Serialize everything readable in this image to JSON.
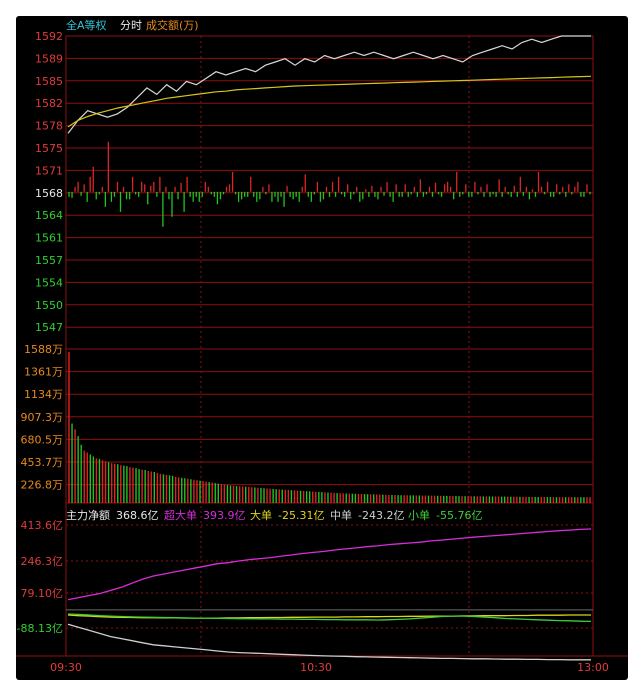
{
  "header": {
    "title": "全A等权",
    "mode": "分时",
    "volume_label": "成交额(万)"
  },
  "colors": {
    "bg": "#000000",
    "grid": "#8c0f0f",
    "axis_red": "#e23b3b",
    "axis_green": "#2fd02f",
    "axis_orange": "#e8891e",
    "title_cyan": "#2fc6d6",
    "price_line": "#d8d8d8",
    "avg_line": "#d6c61a",
    "up_bar": "#e02424",
    "down_bar": "#22c322",
    "super_large": "#d72ed7",
    "large": "#e0d418",
    "medium": "#cfcfcf",
    "small": "#3ccf3c"
  },
  "chart_data": [
    {
      "type": "line",
      "title": "全A等权 分时",
      "y_ticks": [
        "1592",
        "1589",
        "1585",
        "1582",
        "1578",
        "1575",
        "1571",
        "1568",
        "1564",
        "1561",
        "1557",
        "1554",
        "1550",
        "1547"
      ],
      "ylim": [
        1545,
        1593
      ],
      "x_ticks": [
        "09:30",
        "10:30",
        "13:00"
      ],
      "series": [
        {
          "name": "price",
          "values": [
            1577,
            1579,
            1580.5,
            1580,
            1579.5,
            1580,
            1581,
            1582.5,
            1584,
            1583,
            1584.5,
            1583.5,
            1585,
            1584.5,
            1585.5,
            1586.5,
            1586,
            1586.5,
            1587,
            1586.5,
            1587.5,
            1588,
            1588.5,
            1587.5,
            1588.5,
            1588,
            1589,
            1588.5,
            1589,
            1589.5,
            1589,
            1589.5,
            1589,
            1588.5,
            1589,
            1589.5,
            1589,
            1588.5,
            1589,
            1588.5,
            1588,
            1589,
            1589.5,
            1590,
            1590.5,
            1590,
            1591,
            1591.5,
            1591,
            1591.5,
            1592,
            1592,
            1592,
            1592
          ]
        },
        {
          "name": "average",
          "values": [
            1578,
            1579,
            1579.6,
            1580.1,
            1580.5,
            1580.9,
            1581.2,
            1581.5,
            1581.8,
            1582.1,
            1582.4,
            1582.6,
            1582.8,
            1583,
            1583.2,
            1583.4,
            1583.5,
            1583.7,
            1583.8,
            1583.9,
            1584,
            1584.1,
            1584.2,
            1584.3,
            1584.35,
            1584.4,
            1584.45,
            1584.5,
            1584.55,
            1584.6,
            1584.65,
            1584.7,
            1584.75,
            1584.8,
            1584.85,
            1584.9,
            1584.95,
            1585,
            1585.05,
            1585.1,
            1585.15,
            1585.2,
            1585.25,
            1585.3,
            1585.35,
            1585.4,
            1585.45,
            1585.5,
            1585.55,
            1585.6,
            1585.65,
            1585.7,
            1585.75,
            1585.8
          ]
        }
      ],
      "baseline": 1568,
      "momentum_bars": [
        -1,
        -1.2,
        1,
        2,
        -0.8,
        1.5,
        -2,
        3,
        5,
        -1.5,
        -0.5,
        1,
        -3,
        10,
        -2,
        -1,
        2,
        -4,
        1,
        -1.5,
        -1.5,
        3,
        -0.5,
        -1,
        2,
        1.5,
        -2.5,
        1.2,
        2,
        -1,
        3,
        -7,
        1,
        -1.5,
        -5,
        1,
        -1.5,
        1.8,
        -4,
        3,
        -1,
        -2,
        -1,
        -2,
        -1,
        2,
        1,
        -0.5,
        -1,
        -2.5,
        -1.5,
        -0.5,
        1,
        1.5,
        4,
        -0.5,
        -2,
        -1.5,
        -1,
        -1,
        3,
        -1,
        -2,
        -1.5,
        1,
        -0.5,
        1.5,
        -2,
        -1,
        -2,
        -1,
        -3,
        1.2,
        -1,
        -1.5,
        -1,
        -2,
        1,
        3.5,
        -1,
        -2,
        -0.5,
        2,
        -2,
        -1.5,
        1,
        -1,
        2,
        -1,
        3,
        -0.5,
        -1,
        1.5,
        -1.5,
        -0.5,
        1,
        -2,
        -1.5,
        0.5,
        -1,
        1.2,
        -1,
        -1.5,
        1,
        -0.8,
        2,
        -1,
        -2,
        1.5,
        -1,
        -1,
        1.5,
        -1,
        -0.5,
        1,
        -1,
        2.5,
        -1,
        -0.5,
        1,
        -1,
        1.8,
        -0.5,
        -1,
        1.5,
        2,
        1,
        -1.5,
        4,
        -1,
        -0.5,
        1.5,
        -1,
        -1,
        2,
        -0.5,
        1,
        -1,
        1.5,
        -1,
        -0.5,
        -1,
        2.5,
        -1,
        1,
        -0.5,
        -1,
        1.2,
        -1,
        3,
        -0.8,
        1,
        -1.5,
        0.5,
        -1,
        4,
        1,
        -0.5,
        2,
        -1,
        -1,
        1.5,
        -0.5,
        1,
        -1,
        1.5,
        -0.5,
        1,
        2,
        -1,
        -1,
        1.5,
        -0.5
      ]
    },
    {
      "type": "bar",
      "title": "成交额(万)",
      "y_ticks": [
        "1588万",
        "1361万",
        "1134万",
        "907.3万",
        "680.5万",
        "453.7万",
        "226.8万"
      ],
      "ylim": [
        0,
        1588
      ],
      "values": [
        1560,
        820,
        760,
        690,
        600,
        540,
        520,
        500,
        480,
        460,
        455,
        440,
        430,
        420,
        410,
        405,
        400,
        390,
        385,
        380,
        370,
        365,
        360,
        350,
        345,
        340,
        330,
        325,
        320,
        310,
        300,
        295,
        290,
        285,
        280,
        270,
        265,
        260,
        255,
        250,
        245,
        240,
        235,
        230,
        225,
        220,
        215,
        210,
        205,
        200,
        195,
        190,
        185,
        180,
        178,
        175,
        172,
        170,
        168,
        165,
        162,
        160,
        158,
        155,
        152,
        150,
        148,
        145,
        142,
        140,
        138,
        136,
        134,
        132,
        130,
        128,
        126,
        124,
        122,
        120,
        118,
        116,
        114,
        112,
        110,
        108,
        106,
        104,
        102,
        100,
        99,
        98,
        97,
        96,
        95,
        94,
        93,
        92,
        91,
        90,
        89,
        88,
        87,
        86,
        85,
        84,
        83,
        82,
        81,
        80,
        80,
        80,
        79,
        79,
        78,
        78,
        77,
        77,
        76,
        76,
        75,
        75,
        74,
        74,
        73,
        73,
        72,
        72,
        71,
        71,
        70,
        70,
        70,
        69,
        69,
        69,
        68,
        68,
        68,
        67,
        67,
        67,
        66,
        66,
        66,
        65,
        65,
        65,
        64,
        64,
        64,
        63,
        63,
        63,
        62,
        62,
        62,
        61,
        61,
        61,
        60,
        60,
        60,
        60,
        60,
        60,
        60,
        60,
        60,
        60,
        60,
        60
      ]
    },
    {
      "type": "line",
      "title": "主力净额",
      "y_ticks": [
        "413.6亿",
        "246.3亿",
        "79.10亿",
        "-88.13亿"
      ],
      "ylim": [
        -200,
        430
      ],
      "legend": [
        {
          "name": "主力净额",
          "value": "368.6亿"
        },
        {
          "name": "超大单",
          "value": "393.9亿"
        },
        {
          "name": "大单",
          "value": "-25.31亿"
        },
        {
          "name": "中单",
          "value": "-243.2亿"
        },
        {
          "name": "小单",
          "value": "-55.76亿"
        }
      ],
      "series": [
        {
          "name": "超大单",
          "values": [
            50,
            60,
            70,
            80,
            95,
            110,
            130,
            150,
            165,
            175,
            185,
            195,
            205,
            215,
            225,
            230,
            238,
            245,
            250,
            255,
            262,
            268,
            275,
            280,
            285,
            292,
            297,
            302,
            308,
            312,
            318,
            322,
            326,
            330,
            336,
            340,
            345,
            350,
            354,
            358,
            362,
            366,
            370,
            374,
            378,
            382,
            386,
            389,
            392,
            394
          ]
        },
        {
          "name": "大单",
          "values": [
            -25,
            -28,
            -30,
            -33,
            -35,
            -36,
            -37,
            -38,
            -38,
            -39,
            -39,
            -40,
            -40,
            -40,
            -40,
            -39,
            -39,
            -38,
            -38,
            -37,
            -37,
            -36,
            -36,
            -35,
            -35,
            -35,
            -34,
            -34,
            -33,
            -33,
            -32,
            -32,
            -31,
            -31,
            -30,
            -30,
            -30,
            -29,
            -29,
            -28,
            -28,
            -28,
            -27,
            -27,
            -26,
            -26,
            -26,
            -25,
            -25,
            -25
          ]
        },
        {
          "name": "中单",
          "values": [
            -70,
            -85,
            -100,
            -115,
            -130,
            -140,
            -150,
            -160,
            -170,
            -175,
            -180,
            -185,
            -190,
            -195,
            -200,
            -205,
            -208,
            -210,
            -212,
            -214,
            -216,
            -218,
            -220,
            -222,
            -224,
            -225,
            -226,
            -228,
            -229,
            -230,
            -231,
            -232,
            -233,
            -234,
            -235,
            -236,
            -236,
            -237,
            -238,
            -238,
            -239,
            -240,
            -240,
            -241,
            -241,
            -242,
            -242,
            -243,
            -243,
            -243
          ]
        },
        {
          "name": "小单",
          "values": [
            -20,
            -22,
            -25,
            -28,
            -30,
            -32,
            -34,
            -35,
            -36,
            -37,
            -38,
            -39,
            -40,
            -40,
            -41,
            -42,
            -43,
            -43,
            -44,
            -44,
            -45,
            -45,
            -46,
            -46,
            -47,
            -47,
            -48,
            -48,
            -48,
            -49,
            -48,
            -46,
            -44,
            -40,
            -36,
            -32,
            -30,
            -30,
            -32,
            -35,
            -38,
            -42,
            -44,
            -46,
            -48,
            -50,
            -52,
            -53,
            -55,
            -56
          ]
        }
      ]
    }
  ]
}
